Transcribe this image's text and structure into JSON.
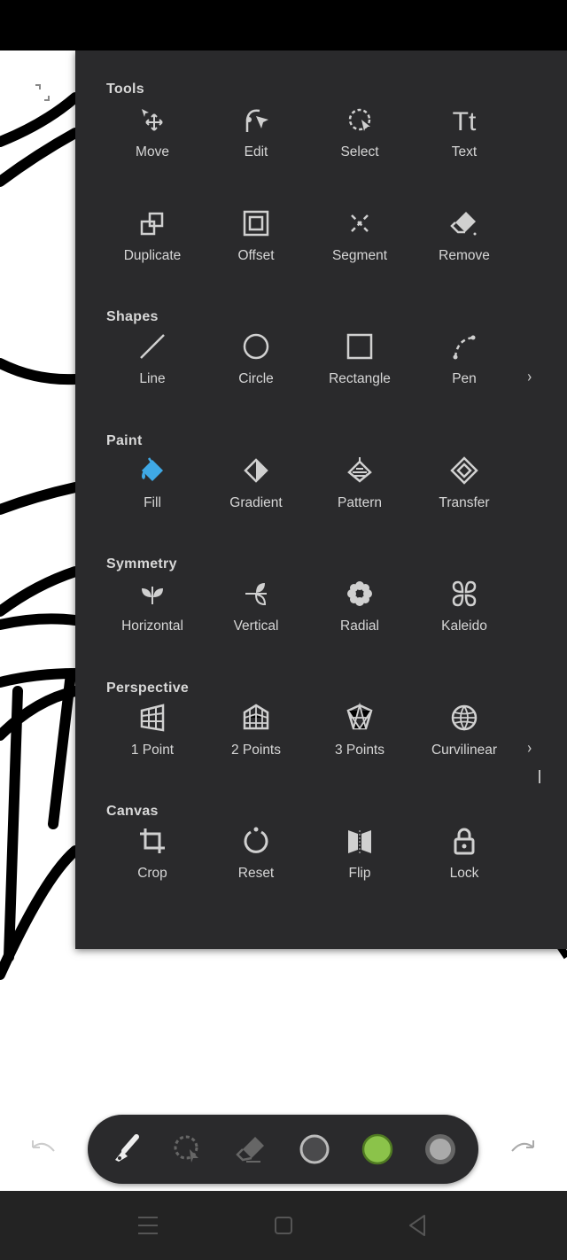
{
  "sections": [
    {
      "title": "Tools",
      "items": [
        {
          "label": "Move",
          "icon": "move-icon"
        },
        {
          "label": "Edit",
          "icon": "edit-icon"
        },
        {
          "label": "Select",
          "icon": "select-icon"
        },
        {
          "label": "Text",
          "icon": "text-icon"
        },
        {
          "label": "Duplicate",
          "icon": "duplicate-icon"
        },
        {
          "label": "Offset",
          "icon": "offset-icon"
        },
        {
          "label": "Segment",
          "icon": "segment-icon"
        },
        {
          "label": "Remove",
          "icon": "eraser-icon"
        }
      ]
    },
    {
      "title": "Shapes",
      "items": [
        {
          "label": "Line",
          "icon": "line-icon"
        },
        {
          "label": "Circle",
          "icon": "circle-icon"
        },
        {
          "label": "Rectangle",
          "icon": "rectangle-icon"
        },
        {
          "label": "Pen",
          "icon": "pen-icon"
        }
      ]
    },
    {
      "title": "Paint",
      "items": [
        {
          "label": "Fill",
          "icon": "fill-bucket-icon"
        },
        {
          "label": "Gradient",
          "icon": "gradient-icon"
        },
        {
          "label": "Pattern",
          "icon": "pattern-icon"
        },
        {
          "label": "Transfer",
          "icon": "transfer-icon"
        }
      ]
    },
    {
      "title": "Symmetry",
      "items": [
        {
          "label": "Horizontal",
          "icon": "horizontal-symmetry-icon"
        },
        {
          "label": "Vertical",
          "icon": "vertical-symmetry-icon"
        },
        {
          "label": "Radial",
          "icon": "radial-symmetry-icon"
        },
        {
          "label": "Kaleido",
          "icon": "kaleido-icon"
        }
      ]
    },
    {
      "title": "Perspective",
      "items": [
        {
          "label": "1 Point",
          "icon": "one-point-perspective-icon"
        },
        {
          "label": "2 Points",
          "icon": "two-point-perspective-icon"
        },
        {
          "label": "3 Points",
          "icon": "three-point-perspective-icon"
        },
        {
          "label": "Curvilinear",
          "icon": "curvilinear-icon"
        }
      ]
    },
    {
      "title": "Canvas",
      "items": [
        {
          "label": "Crop",
          "icon": "crop-icon"
        },
        {
          "label": "Reset",
          "icon": "reset-icon"
        },
        {
          "label": "Flip",
          "icon": "flip-icon"
        },
        {
          "label": "Lock",
          "icon": "lock-icon"
        }
      ]
    }
  ],
  "colors": {
    "accent": "#3fa9e6",
    "panel": "#2a2a2c",
    "active_color": "#8bc34a"
  },
  "toolbar": [
    "brush-icon",
    "lasso-select-icon",
    "eraser-icon",
    "brush-size-icon",
    "color-swatch",
    "opacity-icon"
  ]
}
